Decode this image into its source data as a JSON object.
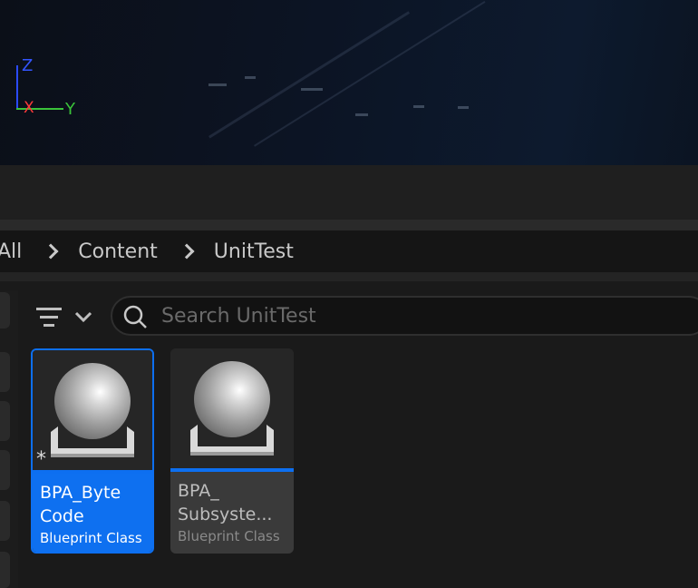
{
  "viewport": {
    "axis_labels": {
      "z": "Z",
      "x": "X",
      "y": "Y"
    },
    "colors": {
      "z": "#2b4bff",
      "x": "#ff3a3a",
      "y": "#3ac33a"
    }
  },
  "breadcrumb": {
    "items": [
      "All",
      "Content",
      "UnitTest"
    ]
  },
  "toolbar": {
    "filter_icon": "filter-lines-icon",
    "search": {
      "placeholder": "Search UnitTest",
      "value": ""
    }
  },
  "assets": [
    {
      "name": "BPA_Byte\nCode",
      "type": "Blueprint Class",
      "selected": true,
      "modified_marker": "*"
    },
    {
      "name": "BPA_\nSubsyste...",
      "type": "Blueprint Class",
      "selected": false
    }
  ],
  "colors": {
    "accent": "#0d6ff0",
    "background": "#1a1a1a"
  }
}
